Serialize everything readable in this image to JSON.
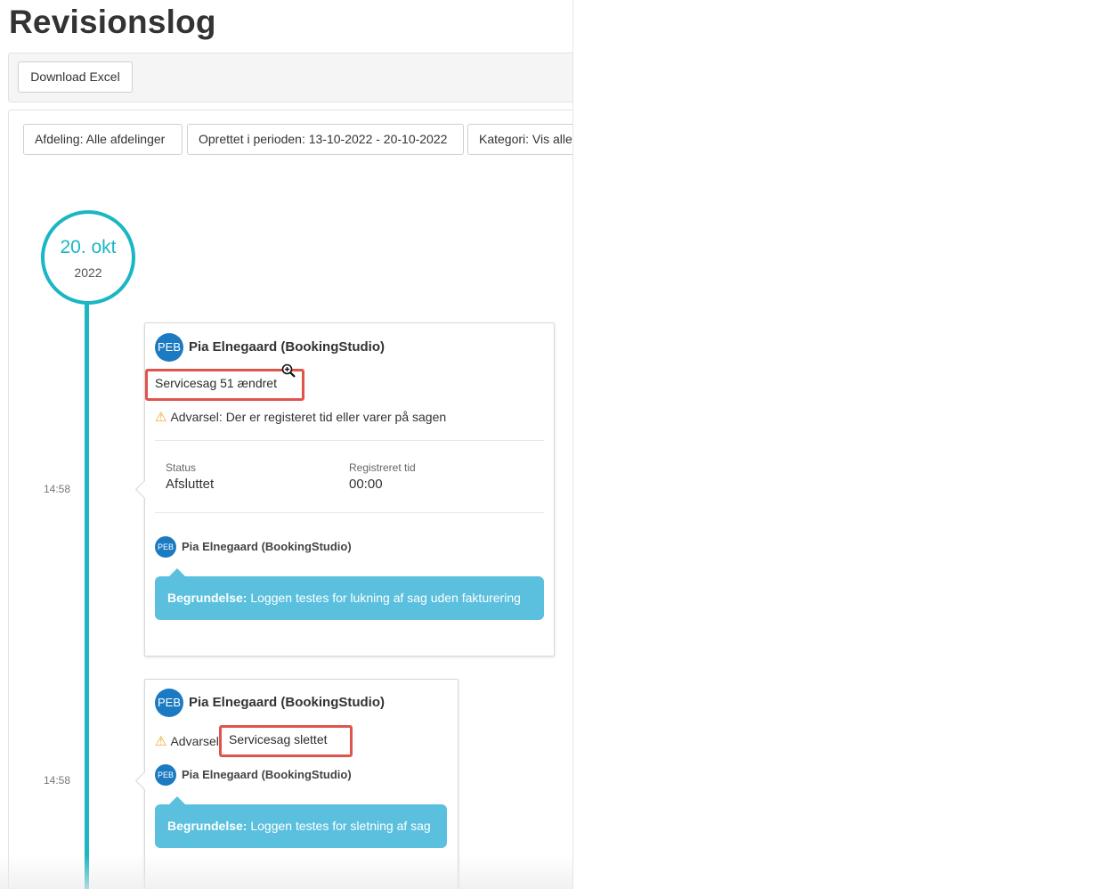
{
  "page": {
    "title": "Revisionslog"
  },
  "toolbar": {
    "download_label": "Download Excel"
  },
  "filters": {
    "department": "Afdeling: Alle afdelinger",
    "period": "Oprettet i perioden: 13-10-2022 - 20-10-2022",
    "category": "Kategori: Vis alle"
  },
  "timeline": {
    "date_day": "20. okt",
    "date_year": "2022",
    "entries": [
      {
        "time": "14:58",
        "avatar": "PEB",
        "user": "Pia Elnegaard (BookingStudio)",
        "event": "Servicesag 51 ændret",
        "warning": "Advarsel: Der er registeret tid eller varer på sagen",
        "fields": [
          {
            "label": "Status",
            "value": "Afsluttet"
          },
          {
            "label": "Registreret tid",
            "value": "00:00"
          }
        ],
        "comment_user": "Pia Elnegaard (BookingStudio)",
        "reason_label": "Begrundelse:",
        "reason_text": "Loggen testes for lukning af sag uden fakturering"
      },
      {
        "time": "14:58",
        "avatar": "PEB",
        "user": "Pia Elnegaard (BookingStudio)",
        "warning_prefix": "Advarsel",
        "event": "Servicesag slettet",
        "comment_user": "Pia Elnegaard (BookingStudio)",
        "reason_label": "Begrundelse:",
        "reason_text": "Loggen testes for sletning af sag"
      }
    ]
  },
  "colors": {
    "accent": "#1ab6c4",
    "avatar": "#1b7ac2",
    "highlight_border": "#e0544c",
    "reason_bubble": "#5bc0de",
    "warning": "#f0a11a"
  },
  "icons": [
    "warning-triangle-icon",
    "zoom-in-icon"
  ]
}
